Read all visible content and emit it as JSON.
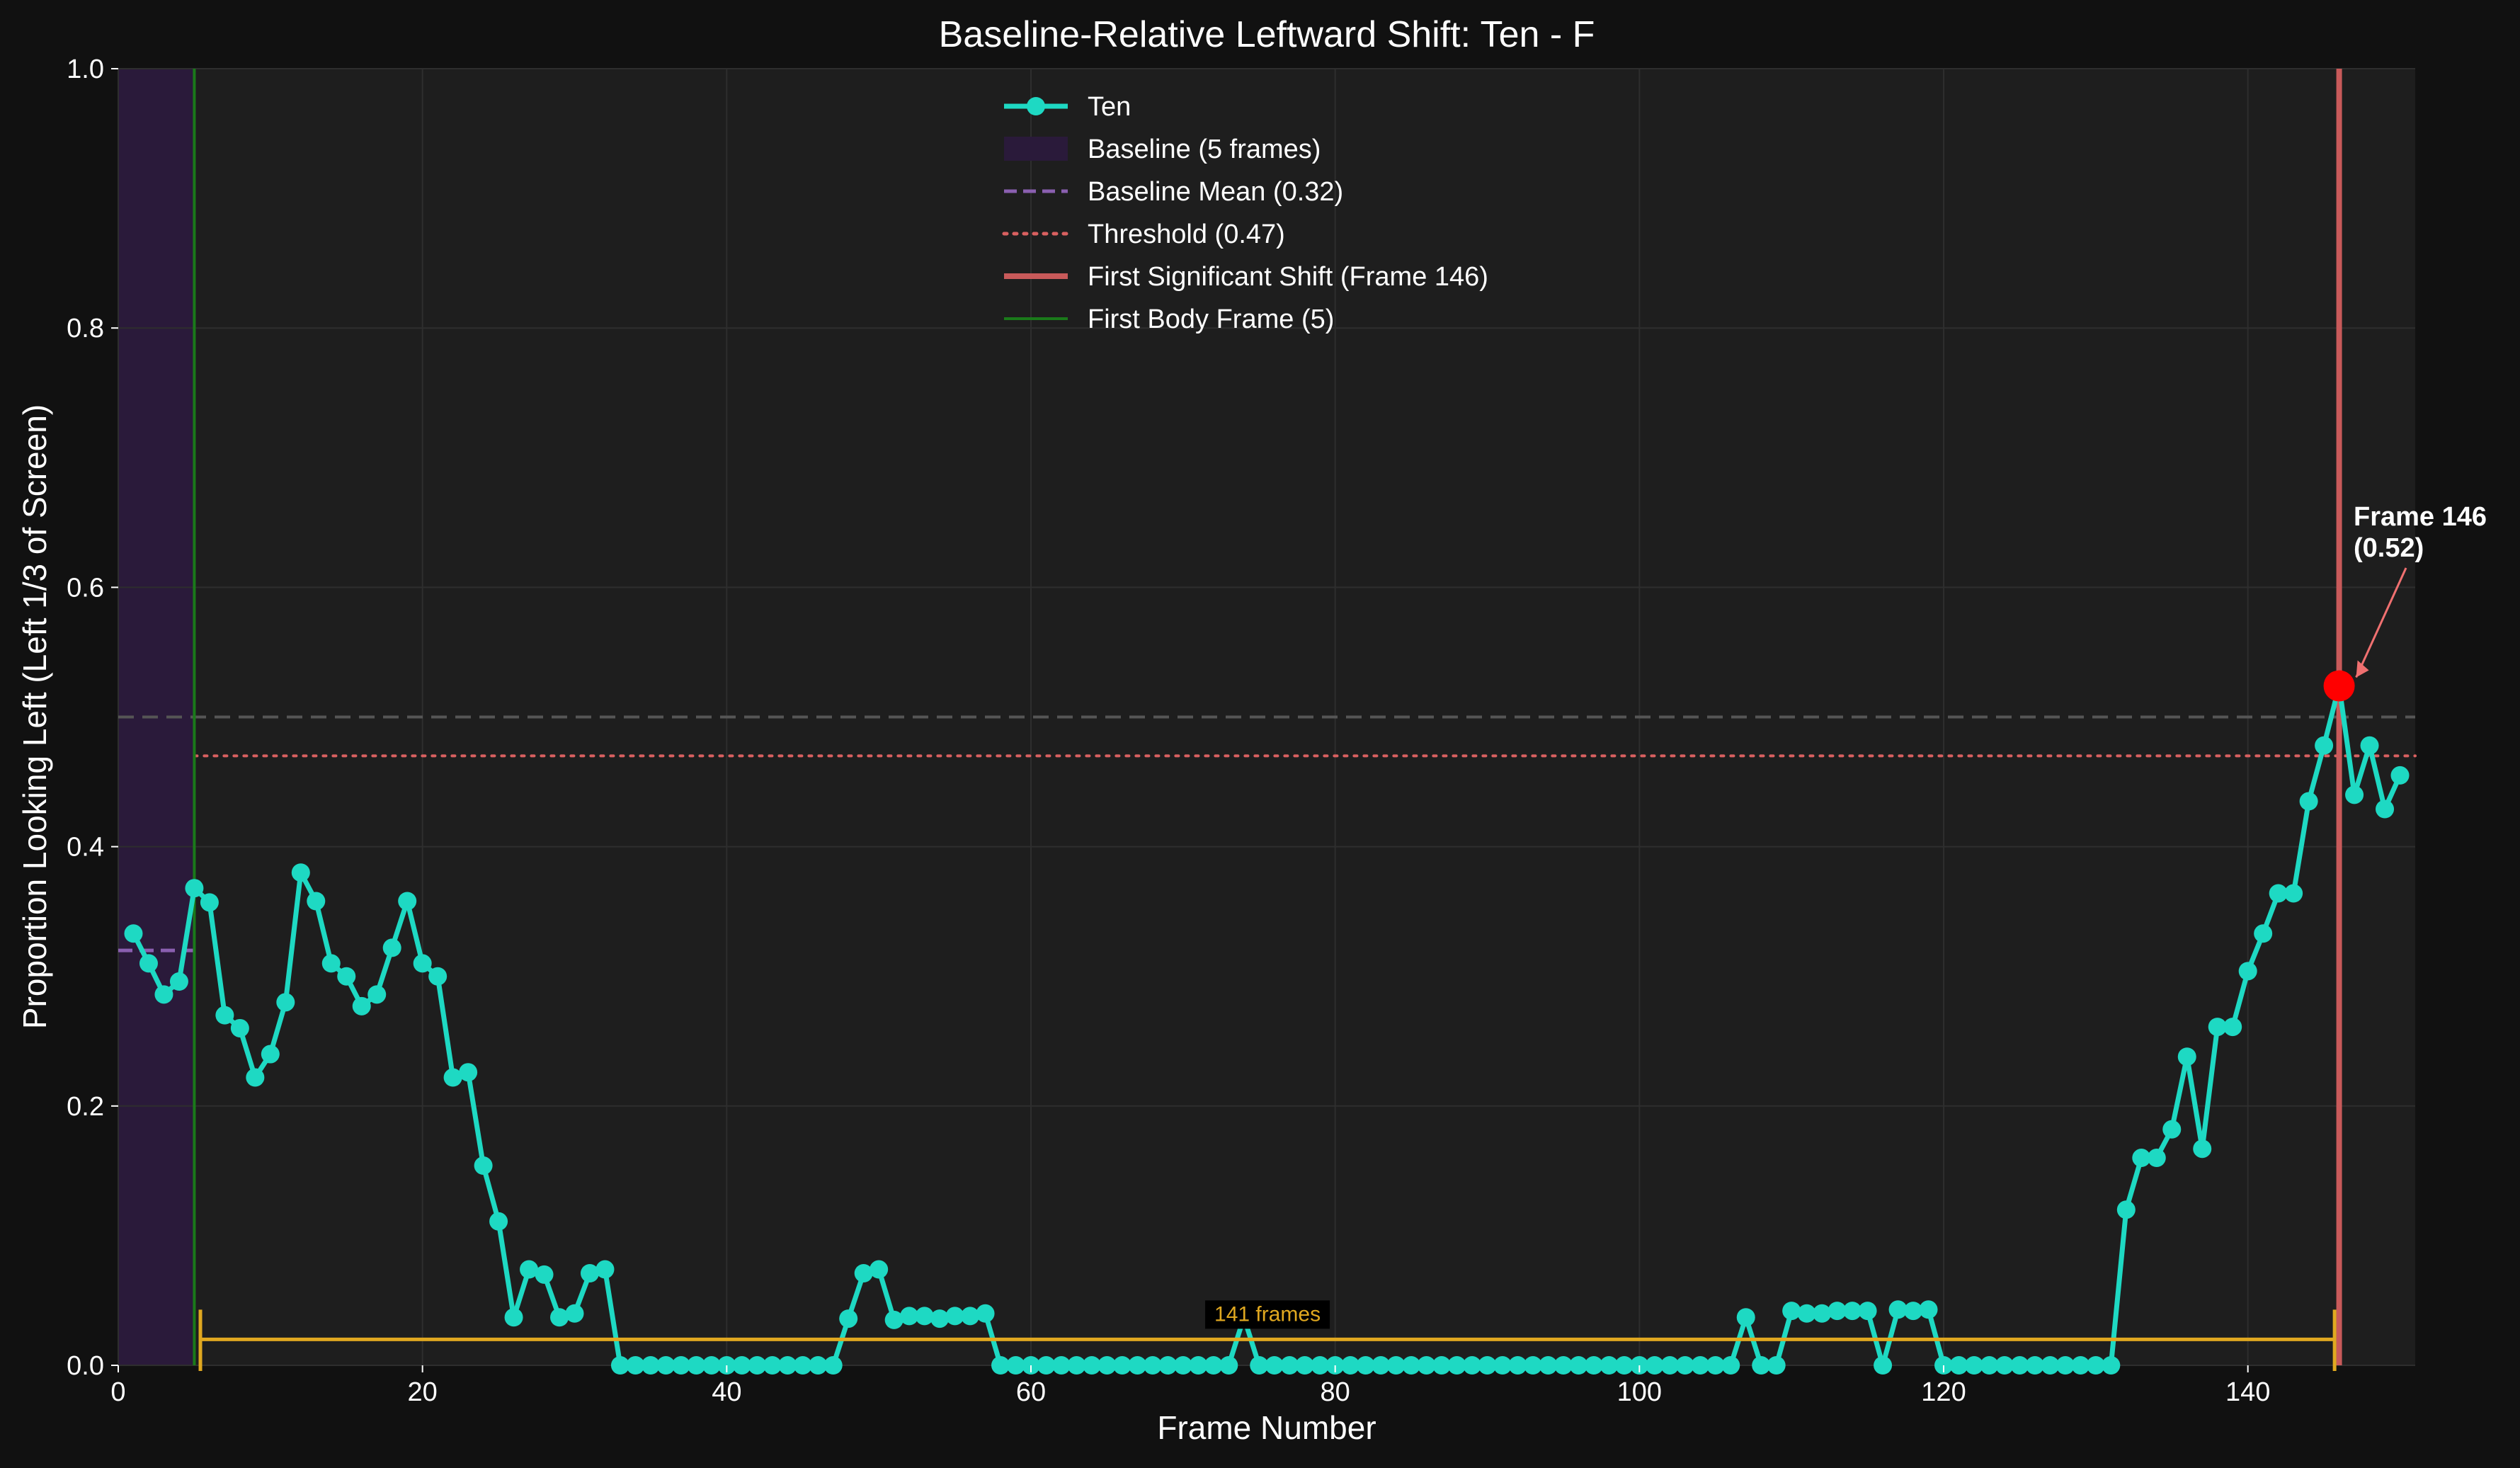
{
  "chart_data": {
    "type": "line",
    "title": "Baseline-Relative Leftward Shift: Ten - F",
    "xlabel": "Frame Number",
    "ylabel": "Proportion Looking Left (Left 1/3 of Screen)",
    "xlim": [
      0,
      151
    ],
    "ylim": [
      0,
      1.0
    ],
    "xticks": [
      0,
      20,
      40,
      60,
      80,
      100,
      120,
      140
    ],
    "yticks": [
      0.0,
      0.2,
      0.4,
      0.6,
      0.8,
      1.0
    ],
    "xtick_labels": [
      "0",
      "20",
      "40",
      "60",
      "80",
      "100",
      "120",
      "140"
    ],
    "ytick_labels": [
      "0.0",
      "0.2",
      "0.4",
      "0.6",
      "0.8",
      "1.0"
    ],
    "grid": true,
    "legend_position": "top-center",
    "series": [
      {
        "name": "Ten",
        "color": "#1ed9c3",
        "x": [
          1,
          2,
          3,
          4,
          5,
          6,
          7,
          8,
          9,
          10,
          11,
          12,
          13,
          14,
          15,
          16,
          17,
          18,
          19,
          20,
          21,
          22,
          23,
          24,
          25,
          26,
          27,
          28,
          29,
          30,
          31,
          32,
          33,
          34,
          35,
          36,
          37,
          38,
          39,
          40,
          41,
          42,
          43,
          44,
          45,
          46,
          47,
          48,
          49,
          50,
          51,
          52,
          53,
          54,
          55,
          56,
          57,
          58,
          59,
          60,
          61,
          62,
          63,
          64,
          65,
          66,
          67,
          68,
          69,
          70,
          71,
          72,
          73,
          74,
          75,
          76,
          77,
          78,
          79,
          80,
          81,
          82,
          83,
          84,
          85,
          86,
          87,
          88,
          89,
          90,
          91,
          92,
          93,
          94,
          95,
          96,
          97,
          98,
          99,
          100,
          101,
          102,
          103,
          104,
          105,
          106,
          107,
          108,
          109,
          110,
          111,
          112,
          113,
          114,
          115,
          116,
          117,
          118,
          119,
          120,
          121,
          122,
          123,
          124,
          125,
          126,
          127,
          128,
          129,
          130,
          131,
          132,
          133,
          134,
          135,
          136,
          137,
          138,
          139,
          140,
          141,
          142,
          143,
          144,
          145,
          146,
          147,
          148,
          149,
          150
        ],
        "y": [
          0.333,
          0.31,
          0.286,
          0.296,
          0.368,
          0.357,
          0.27,
          0.26,
          0.222,
          0.24,
          0.28,
          0.38,
          0.358,
          0.31,
          0.3,
          0.277,
          0.286,
          0.322,
          0.358,
          0.31,
          0.3,
          0.222,
          0.226,
          0.154,
          0.111,
          0.037,
          0.074,
          0.07,
          0.037,
          0.04,
          0.071,
          0.074,
          0.0,
          0.0,
          0.0,
          0.0,
          0.0,
          0.0,
          0.0,
          0.0,
          0.0,
          0.0,
          0.0,
          0.0,
          0.0,
          0.0,
          0.0,
          0.036,
          0.071,
          0.074,
          0.035,
          0.038,
          0.038,
          0.036,
          0.038,
          0.038,
          0.04,
          0.0,
          0.0,
          0.0,
          0.0,
          0.0,
          0.0,
          0.0,
          0.0,
          0.0,
          0.0,
          0.0,
          0.0,
          0.0,
          0.0,
          0.0,
          0.0,
          0.037,
          0.0,
          0.0,
          0.0,
          0.0,
          0.0,
          0.0,
          0.0,
          0.0,
          0.0,
          0.0,
          0.0,
          0.0,
          0.0,
          0.0,
          0.0,
          0.0,
          0.0,
          0.0,
          0.0,
          0.0,
          0.0,
          0.0,
          0.0,
          0.0,
          0.0,
          0.0,
          0.0,
          0.0,
          0.0,
          0.0,
          0.0,
          0.0,
          0.037,
          0.0,
          0.0,
          0.042,
          0.04,
          0.04,
          0.042,
          0.042,
          0.042,
          0.0,
          0.043,
          0.042,
          0.043,
          0.0,
          0.0,
          0.0,
          0.0,
          0.0,
          0.0,
          0.0,
          0.0,
          0.0,
          0.0,
          0.0,
          0.0,
          0.12,
          0.16,
          0.16,
          0.182,
          0.238,
          0.167,
          0.261,
          0.261,
          0.304,
          0.333,
          0.364,
          0.364,
          0.435,
          0.478,
          0.524,
          0.44,
          0.478,
          0.429,
          0.455
        ]
      }
    ],
    "baseline_region": {
      "x_start": 0,
      "x_end": 5,
      "color": "#2a1a3a"
    },
    "baseline_mean": {
      "value": 0.32,
      "x_start": 0,
      "x_end": 5,
      "color": "#8a5fb0"
    },
    "threshold": {
      "value": 0.47,
      "x_start": 5,
      "x_end": 151,
      "color": "#d96060"
    },
    "reference_line": {
      "value": 0.5,
      "color": "#555555"
    },
    "first_body_frame": {
      "x": 5,
      "color": "#1a7a1a"
    },
    "first_shift": {
      "x": 146,
      "y": 0.524,
      "color": "#c85a5a",
      "marker_color": "#ff0000"
    },
    "annotation": {
      "line1": "Frame 146",
      "line2": "(0.52)",
      "color": "#f07070"
    },
    "bracket": {
      "x_start": 5.4,
      "x_end": 145.7,
      "y": 0.02,
      "label": "141 frames",
      "color": "#e0a820"
    },
    "legend": [
      {
        "label": "Ten",
        "kind": "line-marker",
        "color": "#1ed9c3"
      },
      {
        "label": "Baseline (5 frames)",
        "kind": "patch",
        "color": "#2a1a3a"
      },
      {
        "label": "Baseline Mean (0.32)",
        "kind": "dashed",
        "color": "#8a5fb0"
      },
      {
        "label": "Threshold (0.47)",
        "kind": "dotted",
        "color": "#d96060"
      },
      {
        "label": "First Significant Shift (Frame 146)",
        "kind": "solid",
        "color": "#c85a5a"
      },
      {
        "label": "First Body Frame (5)",
        "kind": "solid-thin",
        "color": "#1a7a1a"
      }
    ],
    "colors": {
      "figure_bg": "#111111",
      "axes_bg": "#1e1e1e",
      "grid": "#2e2e2e",
      "text": "#ffffff"
    }
  }
}
